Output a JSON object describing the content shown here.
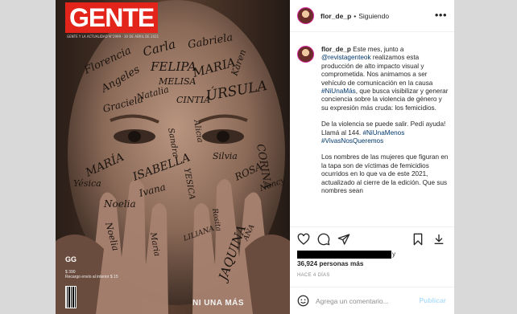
{
  "cover": {
    "logo": "GENTE",
    "subline": "GENTE Y LA ACTUALIDAD N°2999 · 30 DE ABRIL DE 2021",
    "brand": "GG",
    "price": "$ 390",
    "price_sub": "Recargo envío al interior $ 15",
    "footer": "NI UNA MÁS",
    "names": [
      "Florencia",
      "Carla",
      "Gabriela",
      "Angeles",
      "FELIPA",
      "MARIA",
      "Karen",
      "Natalia",
      "MELISA",
      "CINTIA",
      "Graciela",
      "ÚRSULA",
      "MARÍA",
      "Alicia",
      "ISABELLA",
      "Ivana",
      "Yésica",
      "Noelia",
      "Silvia",
      "CORINA",
      "ROSA",
      "Nancy",
      "Noelia",
      "YESICA",
      "Maria",
      "LILIANA",
      "Rosita",
      "JAQUINA",
      "ANA",
      "Sandra"
    ],
    "colors": {
      "logo_red": "#e3241b"
    }
  },
  "post": {
    "header": {
      "username": "flor_de_p",
      "separator": "•",
      "follow_status": "Siguiendo",
      "more_icon": "more-horizontal-icon"
    },
    "caption": {
      "username": "flor_de_p",
      "p1_a": "Este mes, junto a",
      "p1_mention": "@revistagenteok",
      "p1_b": "realizamos esta producción de alto impacto visual y comprometida. Nos animamos a ser vehículo de comunicación en la causa",
      "p1_tag": "#NiUnaMás",
      "p1_c": ", que busca visibilizar y generar conciencia sobre la violencia de género y su expresión más cruda: los femicidios.",
      "p2_a": "De la violencia se puede salir. Pedí ayuda! Llamá al 144.",
      "p2_tag1": "#NiUnaMenos",
      "p2_tag2": "#VivasNosQueremos",
      "p3": "Los nombres de las mujeres que figuran en la tapa son de víctimas de femicidios ocurridos en lo que va de este 2021, actualizado al cierre de la edición. Que sus nombres sean"
    },
    "likes_tail": "y",
    "likes_count": "36,924 personas más",
    "time_ago": "HACE 4 DÍAS",
    "comment": {
      "placeholder": "Agrega un comentario...",
      "publish_label": "Publicar"
    }
  }
}
